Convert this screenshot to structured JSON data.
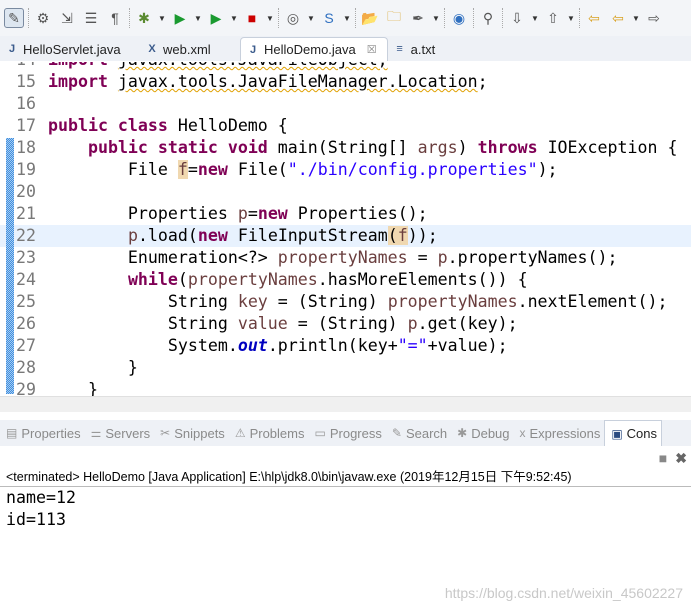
{
  "toolbar": {
    "icons": [
      "edit-icon",
      "gear-icon",
      "import-icon",
      "list-icon",
      "pilcrow-icon",
      "debug-icon",
      "run-icon",
      "run-server-icon",
      "stop-server-icon",
      "new-server-icon",
      "new-service-icon",
      "open-type-icon",
      "open-folder-icon",
      "pen-icon",
      "globe-icon",
      "person-run-icon",
      "next-annotation-icon",
      "prev-annotation-icon",
      "back-edit-icon",
      "back-icon",
      "forward-icon"
    ]
  },
  "tabs": [
    {
      "label": "HelloServlet.java",
      "icon": "java-file-icon"
    },
    {
      "label": "web.xml",
      "icon": "xml-file-icon"
    },
    {
      "label": "HelloDemo.java",
      "icon": "java-file-icon",
      "active": true
    },
    {
      "label": "a.txt",
      "icon": "text-file-icon"
    }
  ],
  "editor": {
    "lines": [
      {
        "n": "14",
        "t": [
          [
            "import ",
            "kw"
          ],
          [
            "javax.tools.JavaFileObject;",
            "sq"
          ]
        ]
      },
      {
        "n": "15",
        "t": [
          [
            "import ",
            "kw"
          ],
          [
            "javax.tools.JavaFileManager.Location",
            "sq"
          ],
          [
            ";",
            ""
          ]
        ]
      },
      {
        "n": "16",
        "t": []
      },
      {
        "n": "17",
        "t": [
          [
            "public class ",
            "kw"
          ],
          [
            "HelloDemo {",
            ""
          ]
        ]
      },
      {
        "n": "18",
        "t": [
          [
            "    ",
            ""
          ],
          [
            "public static void ",
            "kw"
          ],
          [
            "main(String[] ",
            ""
          ],
          [
            "args",
            "var"
          ],
          [
            ") ",
            ""
          ],
          [
            "throws ",
            "kw"
          ],
          [
            "IOException {",
            ""
          ]
        ]
      },
      {
        "n": "19",
        "t": [
          [
            "        File ",
            ""
          ],
          [
            "f",
            "var occ"
          ],
          [
            "=",
            ""
          ],
          [
            "new ",
            "kw"
          ],
          [
            "File(",
            ""
          ],
          [
            "\"./bin/config.properties\"",
            "str"
          ],
          [
            ");",
            ""
          ]
        ]
      },
      {
        "n": "20",
        "t": []
      },
      {
        "n": "21",
        "t": [
          [
            "        Properties ",
            ""
          ],
          [
            "p",
            "var"
          ],
          [
            "=",
            ""
          ],
          [
            "new ",
            "kw"
          ],
          [
            "Properties();",
            ""
          ]
        ]
      },
      {
        "n": "22",
        "cur": true,
        "t": [
          [
            "        ",
            ""
          ],
          [
            "p",
            "var"
          ],
          [
            ".load(",
            ""
          ],
          [
            "new ",
            "kw"
          ],
          [
            "FileInputStream",
            ""
          ],
          [
            "(",
            "occ"
          ],
          [
            "f",
            "var occ"
          ],
          [
            "));",
            ""
          ]
        ]
      },
      {
        "n": "23",
        "t": [
          [
            "        Enumeration<?> ",
            ""
          ],
          [
            "propertyNames",
            "var"
          ],
          [
            " = ",
            ""
          ],
          [
            "p",
            "var"
          ],
          [
            ".propertyNames();",
            ""
          ]
        ]
      },
      {
        "n": "24",
        "t": [
          [
            "        ",
            ""
          ],
          [
            "while",
            "kw"
          ],
          [
            "(",
            ""
          ],
          [
            "propertyNames",
            "var"
          ],
          [
            ".hasMoreElements()) {",
            ""
          ]
        ]
      },
      {
        "n": "25",
        "t": [
          [
            "            String ",
            ""
          ],
          [
            "key",
            "var"
          ],
          [
            " = (String) ",
            ""
          ],
          [
            "propertyNames",
            "var"
          ],
          [
            ".nextElement();",
            ""
          ]
        ]
      },
      {
        "n": "26",
        "t": [
          [
            "            String ",
            ""
          ],
          [
            "value",
            "var"
          ],
          [
            " = (String) ",
            ""
          ],
          [
            "p",
            "var"
          ],
          [
            ".get(key);",
            ""
          ]
        ]
      },
      {
        "n": "27",
        "t": [
          [
            "            System.",
            ""
          ],
          [
            "out",
            "fld"
          ],
          [
            ".println(key+",
            ""
          ],
          [
            "\"=\"",
            "str"
          ],
          [
            "+value);",
            ""
          ]
        ]
      },
      {
        "n": "28",
        "t": [
          [
            "        }",
            ""
          ]
        ]
      },
      {
        "n": "29",
        "t": [
          [
            "    }",
            ""
          ]
        ]
      }
    ]
  },
  "views": [
    {
      "label": "Properties",
      "icon": "properties-icon"
    },
    {
      "label": "Servers",
      "icon": "servers-icon"
    },
    {
      "label": "Snippets",
      "icon": "snippets-icon"
    },
    {
      "label": "Problems",
      "icon": "problems-icon"
    },
    {
      "label": "Progress",
      "icon": "progress-icon"
    },
    {
      "label": "Search",
      "icon": "search-icon"
    },
    {
      "label": "Debug",
      "icon": "debug-icon"
    },
    {
      "label": "Expressions",
      "icon": "expressions-icon"
    },
    {
      "label": "Cons",
      "icon": "console-icon",
      "active": true
    }
  ],
  "console": {
    "status": "<terminated> HelloDemo [Java Application] E:\\hlp\\jdk8.0\\bin\\javaw.exe (2019年12月15日 下午9:52:45)",
    "output": [
      "name=12",
      "id=113"
    ]
  },
  "watermark": "https://blog.csdn.net/weixin_45602227"
}
